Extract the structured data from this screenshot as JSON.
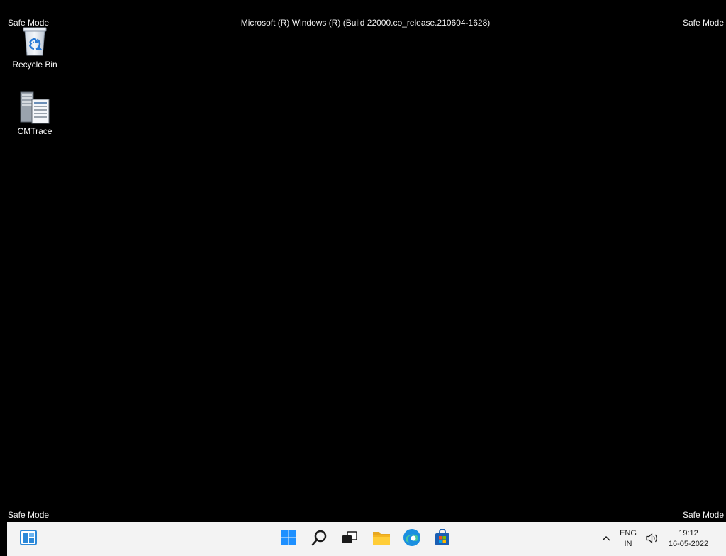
{
  "watermark": {
    "top_left": "Safe Mode",
    "top_right": "Safe Mode",
    "bottom_left": "Safe Mode",
    "bottom_right": "Safe Mode",
    "build_string": "Microsoft (R) Windows (R) (Build 22000.co_release.210604-1628)"
  },
  "desktop": {
    "icons": [
      {
        "label": "Recycle Bin",
        "icon": "recycle-bin-icon"
      },
      {
        "label": "CMTrace",
        "icon": "cmtrace-icon"
      }
    ]
  },
  "taskbar": {
    "apps": [
      {
        "name": "widgets",
        "icon": "widgets-icon"
      },
      {
        "name": "start",
        "icon": "windows-start-icon"
      },
      {
        "name": "search",
        "icon": "search-icon"
      },
      {
        "name": "task-view",
        "icon": "task-view-icon"
      },
      {
        "name": "file-explorer",
        "icon": "folder-icon"
      },
      {
        "name": "edge",
        "icon": "edge-icon"
      },
      {
        "name": "store",
        "icon": "store-icon"
      }
    ],
    "tray": {
      "lang_line1": "ENG",
      "lang_line2": "IN",
      "time": "19:12",
      "date": "16-05-2022"
    }
  },
  "colors": {
    "desktop_bg": "#000000",
    "taskbar_bg": "#f3f3f3",
    "accent_blue": "#0078d4"
  }
}
